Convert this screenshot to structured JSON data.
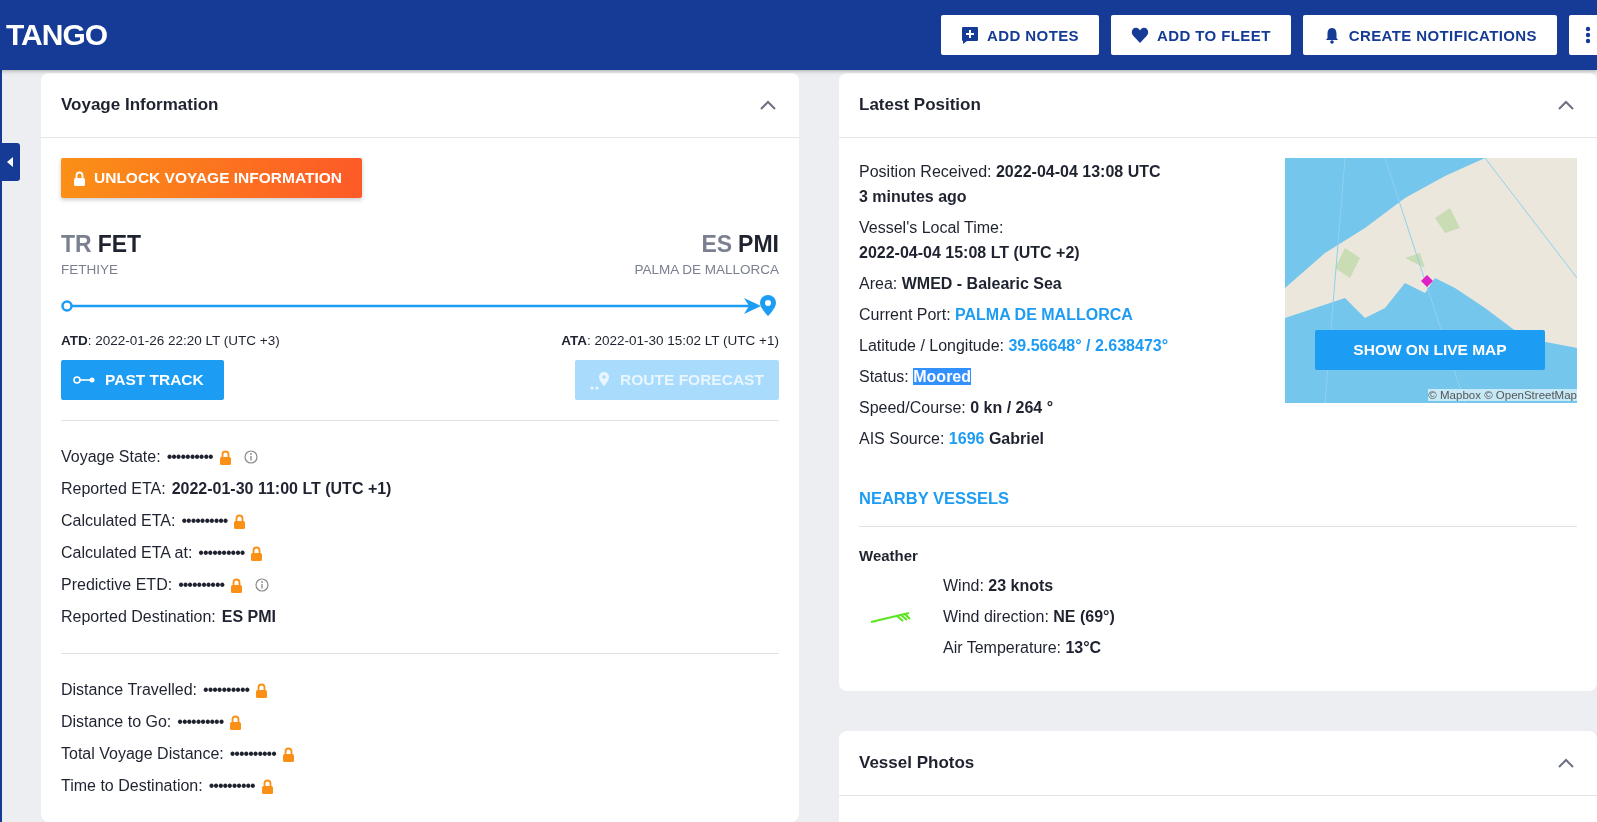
{
  "header": {
    "logo": "TANGO",
    "actions": [
      {
        "kind": "notes",
        "label": "ADD NOTES"
      },
      {
        "kind": "fleet",
        "label": "ADD TO FLEET"
      },
      {
        "kind": "notifications",
        "label": "CREATE NOTIFICATIONS"
      }
    ]
  },
  "voyage": {
    "title": "Voyage Information",
    "unlock_button": "UNLOCK VOYAGE INFORMATION",
    "origin": {
      "country": "TR",
      "code": "FET",
      "name": "FETHIYE"
    },
    "destination": {
      "country": "ES",
      "code": "PMI",
      "name": "PALMA DE MALLORCA"
    },
    "atd": "**ATD**: 2022-01-26 22:20 LT (UTC +3)",
    "ata": "**ATA**: 2022-01-30 15:02 LT (UTC +1)",
    "buttons": [
      {
        "kind": "past_track",
        "label": "PAST TRACK",
        "disabled": false
      },
      {
        "kind": "route_forecast",
        "label": "ROUTE FORECAST",
        "disabled": true
      }
    ],
    "field_groups": [
      [
        {
          "label": "Voyage State:",
          "value": "••••••••••",
          "locked": true,
          "info": true
        },
        {
          "label": "Reported ETA:",
          "value": "2022-01-30 11:00 LT (UTC +1)",
          "locked": false,
          "info": false
        },
        {
          "label": "Calculated ETA:",
          "value": "••••••••••",
          "locked": true,
          "info": false
        },
        {
          "label": "Calculated ETA at:",
          "value": "••••••••••",
          "locked": true,
          "info": false
        },
        {
          "label": "Predictive ETD:",
          "value": "••••••••••",
          "locked": true,
          "info": true
        },
        {
          "label": "Reported Destination:",
          "value": "ES PMI",
          "locked": false,
          "info": false
        }
      ],
      [
        {
          "label": "Distance Travelled:",
          "value": "••••••••••",
          "locked": true,
          "info": false
        },
        {
          "label": "Distance to Go:",
          "value": "••••••••••",
          "locked": true,
          "info": false
        },
        {
          "label": "Total Voyage Distance:",
          "value": "••••••••••",
          "locked": true,
          "info": false
        },
        {
          "label": "Time to Destination:",
          "value": "••••••••••",
          "locked": true,
          "info": false
        }
      ]
    ]
  },
  "latest_position": {
    "title": "Latest Position",
    "rows": [
      {
        "kind": "inline",
        "label": "Position Received:",
        "parts": [
          {
            "kind": "value",
            "text": "2022-04-04 13:08 UTC",
            "selected": false
          }
        ]
      },
      {
        "kind": "note",
        "parts": [
          {
            "kind": "value",
            "text": "3 minutes ago",
            "selected": false
          }
        ]
      },
      {
        "kind": "stacked",
        "label": "Vessel's Local Time:",
        "parts": [
          {
            "kind": "value",
            "text": "2022-04-04 15:08 LT (UTC +2)",
            "selected": false
          }
        ]
      },
      {
        "kind": "inline",
        "label": "Area:",
        "parts": [
          {
            "kind": "value",
            "text": "WMED - Balearic Sea",
            "selected": false
          }
        ]
      },
      {
        "kind": "inline",
        "label": "Current Port:",
        "parts": [
          {
            "kind": "link",
            "text": "PALMA DE MALLORCA",
            "selected": false
          }
        ]
      },
      {
        "kind": "inline",
        "label": "Latitude / Longitude:",
        "parts": [
          {
            "kind": "link",
            "text": "39.56648° / 2.638473°",
            "selected": false
          }
        ]
      },
      {
        "kind": "inline",
        "label": "Status:",
        "parts": [
          {
            "kind": "value",
            "text": "Moored",
            "selected": true
          }
        ]
      },
      {
        "kind": "inline",
        "label": "Speed/Course:",
        "parts": [
          {
            "kind": "value",
            "text": "0 kn / 264 °",
            "selected": false
          }
        ]
      },
      {
        "kind": "inline",
        "label": "AIS Source:",
        "parts": [
          {
            "kind": "link",
            "text": "1696",
            "selected": false
          },
          {
            "kind": "value",
            "text": "Gabriel",
            "selected": false
          }
        ]
      }
    ],
    "map": {
      "button": "SHOW ON LIVE MAP",
      "attribution": "© Mapbox © OpenStreetMap"
    },
    "nearby_link": "NEARBY VESSELS",
    "weather": {
      "title": "Weather",
      "rows": [
        {
          "label": "Wind:",
          "value": "23 knots"
        },
        {
          "label": "Wind direction:",
          "value": "NE (69°)"
        },
        {
          "label": "Air Temperature:",
          "value": "13°C"
        }
      ]
    }
  },
  "vessel_photos": {
    "title": "Vessel Photos"
  }
}
